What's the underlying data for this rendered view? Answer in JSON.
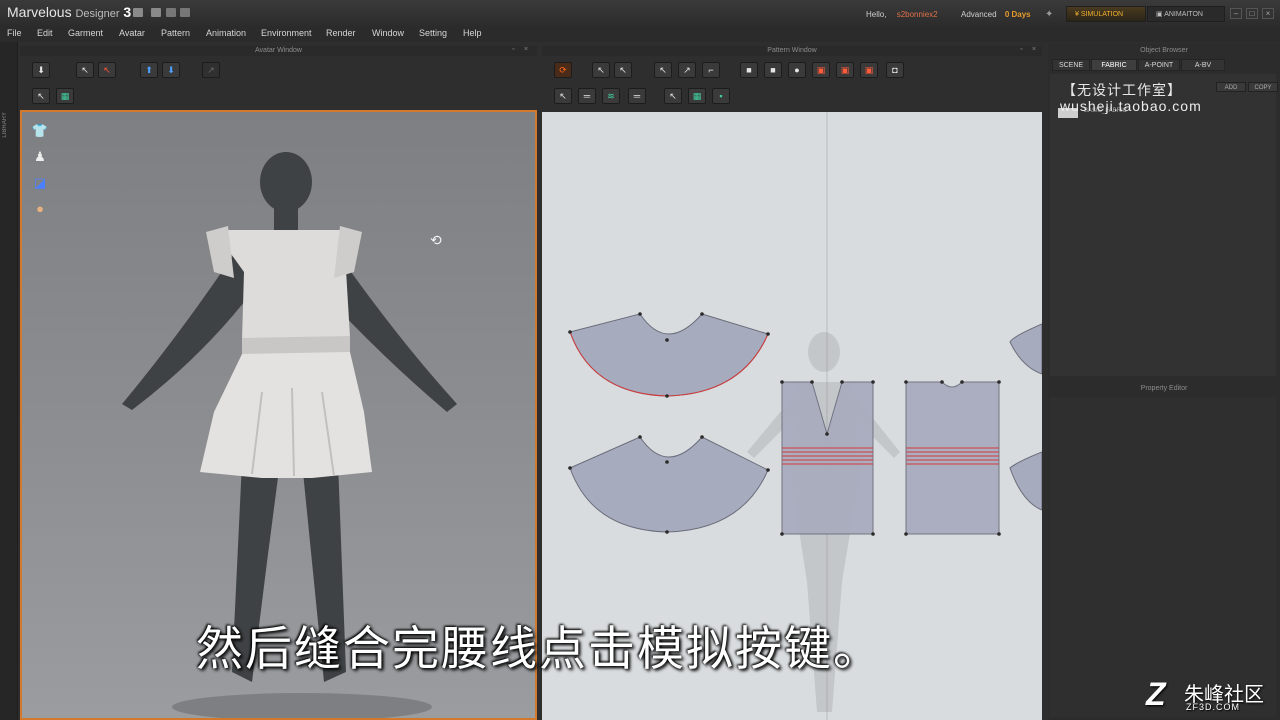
{
  "app": {
    "name_main": "Marvelous",
    "name_sub": "Designer",
    "version": "3"
  },
  "account": {
    "hello_label": "Hello,",
    "username": "s2bonniex2",
    "license_label": "Advanced",
    "days_left": "0 Days"
  },
  "modes": {
    "simulation": "SIMULATION",
    "animation": "ANIMAITON"
  },
  "menu": [
    "File",
    "Edit",
    "Garment",
    "Avatar",
    "Pattern",
    "Animation",
    "Environment",
    "Render",
    "Window",
    "Setting",
    "Help"
  ],
  "panels": {
    "avatar_window": "Avatar Window",
    "pattern_window": "Pattern Window",
    "object_browser": "Object Browser",
    "property_editor": "Property Editor"
  },
  "object_browser": {
    "tabs": [
      "SCENE",
      "FABRIC",
      "A-POINT",
      "A-BV"
    ],
    "active_tab": "FABRIC",
    "add_label": "ADD",
    "copy_label": "COPY",
    "fabric_name": "BASIC_FABRIC"
  },
  "watermark": {
    "line1": "【无设计工作室】",
    "line2": "wusheji.taobao.com"
  },
  "subtitle": "然后缝合完腰线点击模拟按键。",
  "corner_logo": {
    "mark": "Z",
    "name": "朱峰社区",
    "url": "ZF3D.COM"
  },
  "side_strip_label": "LIBRARY",
  "colors": {
    "accent_orange": "#d2792e",
    "pattern_fill": "#a7abbe",
    "seam_red": "#d23a3a"
  }
}
